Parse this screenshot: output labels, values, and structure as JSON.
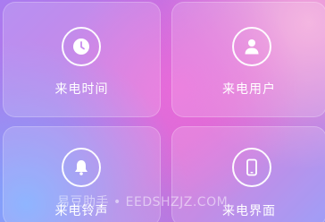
{
  "tiles": [
    {
      "label": "来电时间",
      "icon": "clock-icon"
    },
    {
      "label": "来电用户",
      "icon": "user-icon"
    },
    {
      "label": "来电铃声",
      "icon": "bell-icon"
    },
    {
      "label": "来电界面",
      "icon": "phone-icon"
    }
  ],
  "watermark": "易豆助手 • EEDSHZJZ.COM",
  "colors": {
    "icon_fg": "#ffffff",
    "icon_accent": "#c98cf0"
  }
}
